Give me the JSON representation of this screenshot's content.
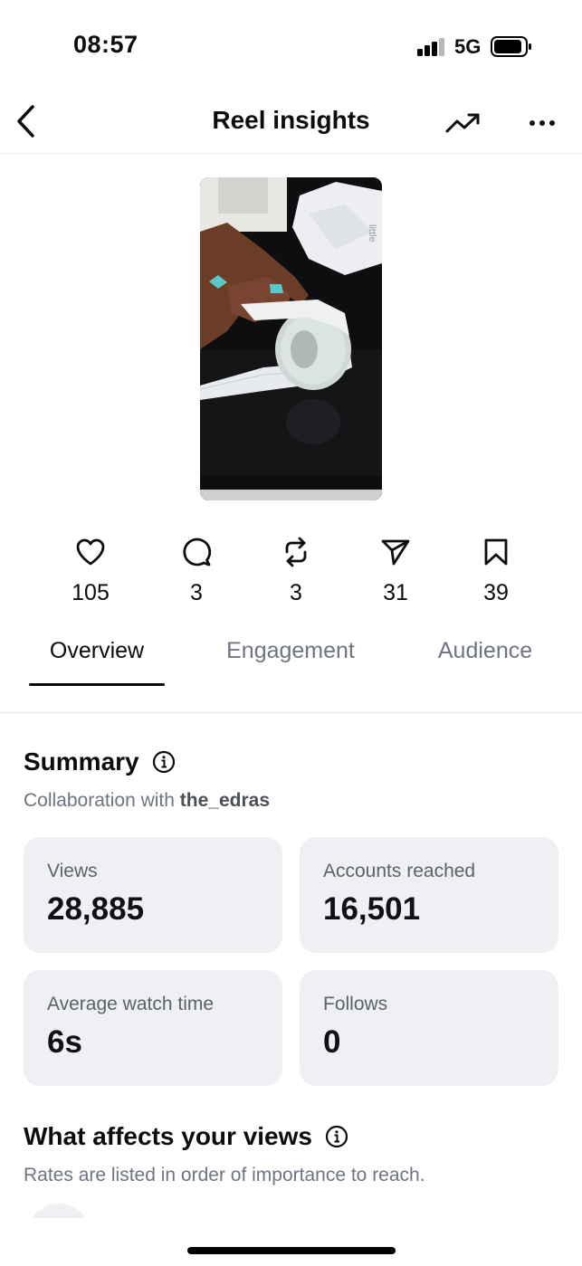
{
  "status_bar": {
    "time": "08:57",
    "network": "5G"
  },
  "header": {
    "title": "Reel insights",
    "back_icon": "chevron-left-icon",
    "trend_icon": "trending-up-icon",
    "more_icon": "more-horizontal-icon"
  },
  "reel": {
    "thumbnail_label": "little"
  },
  "stats": [
    {
      "icon": "heart-icon",
      "value": "105"
    },
    {
      "icon": "comment-icon",
      "value": "3"
    },
    {
      "icon": "repost-icon",
      "value": "3"
    },
    {
      "icon": "share-icon",
      "value": "31"
    },
    {
      "icon": "bookmark-icon",
      "value": "39"
    }
  ],
  "tabs": [
    {
      "label": "Overview",
      "active": true
    },
    {
      "label": "Engagement",
      "active": false
    },
    {
      "label": "Audience",
      "active": false
    }
  ],
  "summary": {
    "title": "Summary",
    "subtitle_prefix": "Collaboration with",
    "collaborator": "the_edras",
    "cards": [
      {
        "label": "Views",
        "value": "28,885"
      },
      {
        "label": "Accounts reached",
        "value": "16,501"
      },
      {
        "label": "Average watch time",
        "value": "6s"
      },
      {
        "label": "Follows",
        "value": "0"
      }
    ]
  },
  "views_section": {
    "title": "What affects your views",
    "subtitle": "Rates are listed in order of importance to reach."
  },
  "colors": {
    "text": "#0c0c0c",
    "muted": "#6e7480",
    "card_bg": "#eff0f4",
    "background": "#ffffff"
  }
}
